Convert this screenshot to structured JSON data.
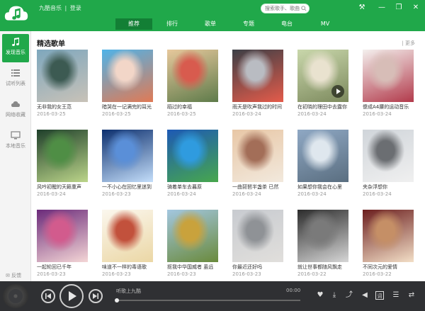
{
  "app": {
    "title": "九酷音乐",
    "separator": "|",
    "login": "登录"
  },
  "search": {
    "placeholder": "搜索歌手、歌曲"
  },
  "nav": {
    "tabs": [
      "推荐",
      "排行",
      "歌单",
      "专题",
      "电台",
      "MV"
    ],
    "active": 0
  },
  "sidebar": {
    "items": [
      {
        "label": "发现音乐",
        "icon": "music-note-icon",
        "active": true
      },
      {
        "label": "试听列表",
        "icon": "list-icon",
        "active": false
      },
      {
        "label": "网络收藏",
        "icon": "cloud-icon",
        "active": false
      },
      {
        "label": "本地音乐",
        "icon": "monitor-icon",
        "active": false
      }
    ],
    "feedback": "反馈"
  },
  "section": {
    "title": "精选歌单",
    "more": "更多"
  },
  "playlists": [
    {
      "title": "无非我的女王范",
      "date": "2016-03-25",
      "colors": [
        "#7ea7bd",
        "#3c5a52",
        "#c8c2b8"
      ]
    },
    {
      "title": "暗哭在一记满完的耳光",
      "date": "2016-03-25",
      "colors": [
        "#4fb3e8",
        "#f2d6c8",
        "#e07a55"
      ]
    },
    {
      "title": "蹈过的幸福",
      "date": "2016-03-25",
      "colors": [
        "#e7c89c",
        "#d85b4e",
        "#5e7b4a"
      ]
    },
    {
      "title": "雨天是吹声我过的时间",
      "date": "2016-03-24",
      "colors": [
        "#3c3f46",
        "#b9bcc2",
        "#e45b4a"
      ]
    },
    {
      "title": "在初晓的理田中去露你",
      "date": "2016-03-24",
      "colors": [
        "#c9d7ab",
        "#e9e2cf",
        "#7d8a5e"
      ]
    },
    {
      "title": "傻成A4腰的运动音乐",
      "date": "2016-03-24",
      "colors": [
        "#f4f0ee",
        "#d7bdb7",
        "#b23a4b"
      ]
    },
    {
      "title": "风吟初醒的天籁重声",
      "date": "2016-03-24",
      "colors": [
        "#1e3f2a",
        "#4f8e45",
        "#bcd58a"
      ]
    },
    {
      "title": "一不小心在回忆里迷到",
      "date": "2016-03-23",
      "colors": [
        "#0c2f6e",
        "#5a8fd8",
        "#c4defa"
      ]
    },
    {
      "title": "骑着单车去暮原",
      "date": "2016-03-24",
      "colors": [
        "#1d59b5",
        "#2f9bdf",
        "#47a74d"
      ]
    },
    {
      "title": "一曲琵琶半盏茶 已然",
      "date": "2016-03-24",
      "colors": [
        "#e8c7a6",
        "#a36e58",
        "#f2e9dd"
      ]
    },
    {
      "title": "如果想你我会在心里",
      "date": "2016-03-24",
      "colors": [
        "#8fa8c4",
        "#dfe7ee",
        "#5a6e80"
      ]
    },
    {
      "title": "夹杂浮想你",
      "date": "2016-03-24",
      "colors": [
        "#d0d5da",
        "#6b6e72",
        "#f0f0f0"
      ]
    },
    {
      "title": "一起轮回已千年",
      "date": "2016-03-23",
      "colors": [
        "#6b2a7a",
        "#d25b8d",
        "#f4d6d6"
      ]
    },
    {
      "title": "味道不一样的毒语歌",
      "date": "2016-03-23",
      "colors": [
        "#fbf7ee",
        "#c2513c",
        "#ebd7a5"
      ]
    },
    {
      "title": "抠我中华国威者 虽远",
      "date": "2016-03-23",
      "colors": [
        "#a3c7e0",
        "#c9a23c",
        "#6a8a3c"
      ]
    },
    {
      "title": "你最近还好吗",
      "date": "2016-03-23",
      "colors": [
        "#c8cbd0",
        "#8f9296",
        "#e1dfdc"
      ]
    },
    {
      "title": "就让世事都随风飘走",
      "date": "2016-03-22",
      "colors": [
        "#2c2c2c",
        "#7a7a7a",
        "#d6d6d6"
      ]
    },
    {
      "title": "不同次元的爱情",
      "date": "2016-03-22",
      "colors": [
        "#6b1e1e",
        "#c58f66",
        "#f3dfc7"
      ]
    }
  ],
  "player": {
    "now_playing": "听歌上九酷",
    "time": "00:00",
    "progress": 0
  }
}
